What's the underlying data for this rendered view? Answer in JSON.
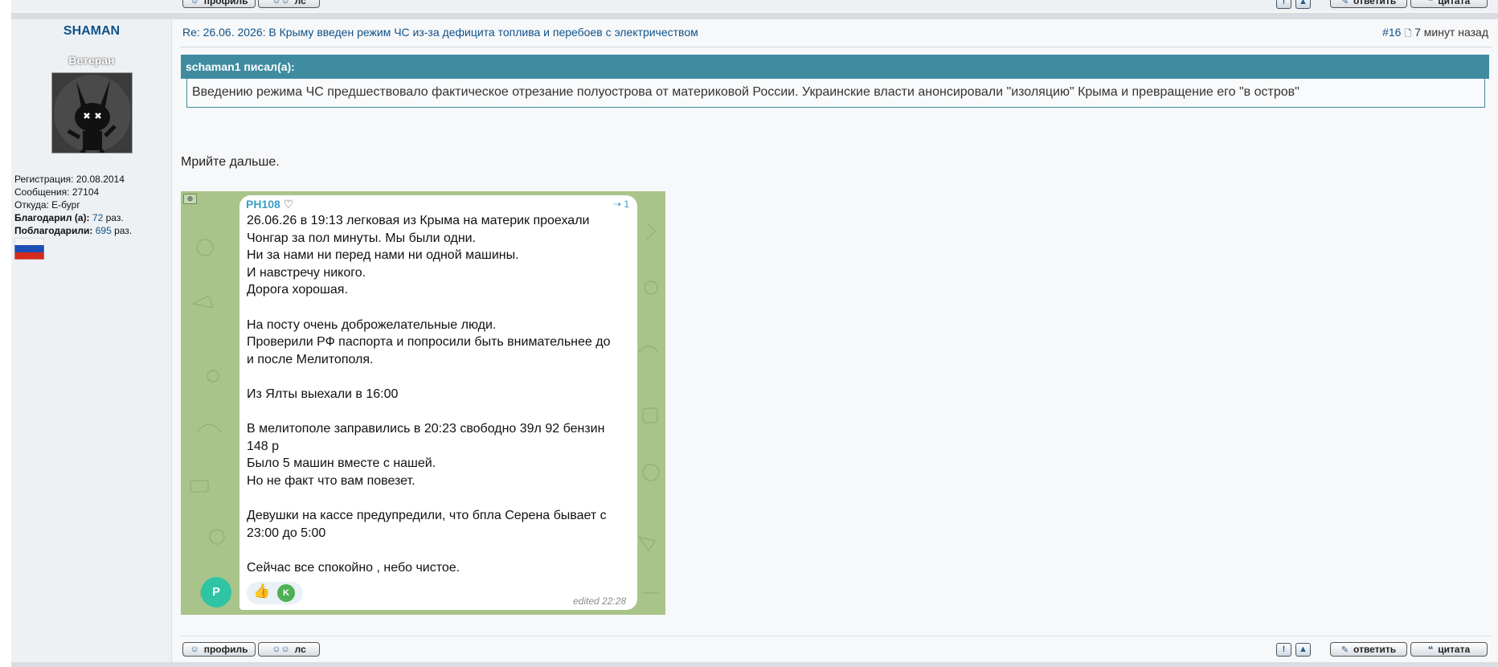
{
  "top_buttons": {
    "profile": "профиль",
    "pm": "лс",
    "reply": "ответить",
    "quote": "цитата"
  },
  "post": {
    "author": "SHAMAN",
    "rank": "Ветеран",
    "title": "Re: 26.06. 2026: В Крыму введен режим ЧС из-за дефицита топлива и перебоев с электричеством",
    "number": "#16",
    "time": "7 минут назад",
    "profile": {
      "registration_label": "Регистрация:",
      "registration": "20.08.2014",
      "messages_label": "Сообщения:",
      "messages": "27104",
      "from_label": "Откуда:",
      "from": "Е-бург",
      "thanked_label": "Благодарил (а):",
      "thanked": "72",
      "thanked_suffix": "раз.",
      "was_thanked_label": "Поблагодарили:",
      "was_thanked": "695",
      "was_thanked_suffix": "раз."
    },
    "quote": {
      "header": "schaman1 писал(а):",
      "text": "Введению режима ЧС предшествовало фактическое отрезание полуострова от материковой России. Украинские власти анонсировали \"изоляцию\" Крыма и превращение его \"в остров\""
    },
    "body": "Мрийте дальше.",
    "telegram": {
      "author": "PH108",
      "views": "1",
      "lines": [
        "26.06.26 в 19:13 легковая из Крыма на материк проехали",
        "Чонгар за пол минуты. Мы были одни.",
        "Ни за нами ни перед нами ни одной машины.",
        "И навстречу никого.",
        "Дорога хорошая.",
        "",
        "На посту очень доброжелательные люди.",
        "Проверили РФ паспорта и попросили быть внимательнее до",
        "и после Мелитополя.",
        "",
        "Из Ялты выехали в 16:00",
        "",
        "В мелитополе заправились в 20:23 свободно 39л 92 бензин",
        "148 р",
        "Было 5 машин вместе с нашей.",
        "Но не факт что вам повезет.",
        "",
        "Девушки на кассе предупредили, что бпла Серена бывает с",
        "23:00 до 5:00",
        "",
        "Сейчас все спокойно , небо чистое."
      ],
      "avatar_letter": "P",
      "reaction_letter": "K",
      "edited": "edited",
      "edited_time": "22:28"
    }
  },
  "bottom_buttons": {
    "profile": "профиль",
    "pm": "лс",
    "reply": "ответить",
    "quote": "цитата"
  },
  "colors": {
    "link": "#105289",
    "quote_header": "#3f8ca1",
    "telegram_bg": "#a9c48a",
    "telegram_link": "#3a9ec5"
  }
}
